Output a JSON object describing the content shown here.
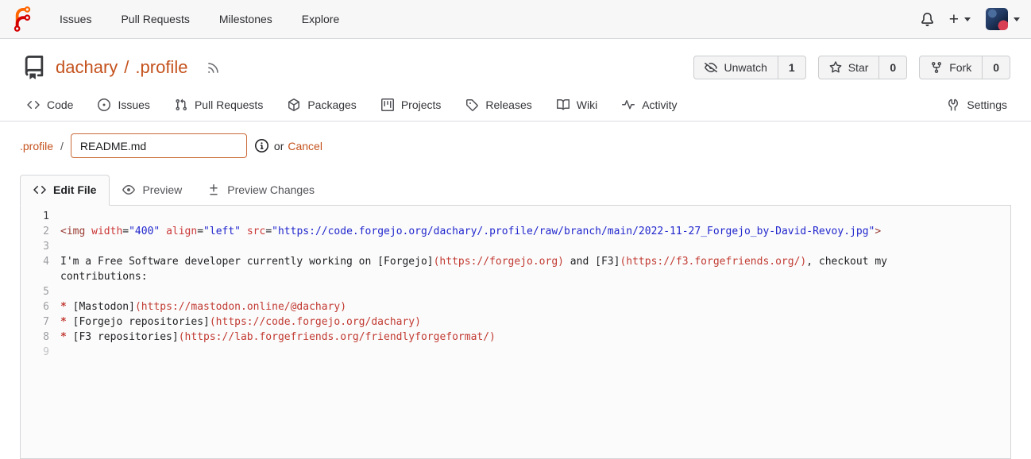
{
  "navbar": {
    "logo_icon": "forgejo-logo",
    "links": [
      "Issues",
      "Pull Requests",
      "Milestones",
      "Explore"
    ],
    "bell_icon": "bell",
    "new_label": "+"
  },
  "repo_header": {
    "repo_icon": "repo",
    "owner": "dachary",
    "separator": "/",
    "name": ".profile",
    "rss_icon": "rss",
    "actions": [
      {
        "icon": "eye-closed",
        "label": "Unwatch",
        "count": "1"
      },
      {
        "icon": "star",
        "label": "Star",
        "count": "0"
      },
      {
        "icon": "fork",
        "label": "Fork",
        "count": "0"
      }
    ]
  },
  "repo_tabs": [
    {
      "icon": "code",
      "label": "Code"
    },
    {
      "icon": "issue",
      "label": "Issues"
    },
    {
      "icon": "pull",
      "label": "Pull Requests"
    },
    {
      "icon": "package",
      "label": "Packages"
    },
    {
      "icon": "project",
      "label": "Projects"
    },
    {
      "icon": "tag",
      "label": "Releases"
    },
    {
      "icon": "book",
      "label": "Wiki"
    },
    {
      "icon": "pulse",
      "label": "Activity"
    }
  ],
  "settings_tab": {
    "icon": "tools",
    "label": "Settings"
  },
  "file_editor": {
    "breadcrumb_dir": ".profile",
    "breadcrumb_sep": "/",
    "filename_value": "README.md",
    "info_icon": "info",
    "or_text": "or",
    "cancel_label": "Cancel",
    "tabs": [
      {
        "icon": "code",
        "label": "Edit File",
        "active": true
      },
      {
        "icon": "eye",
        "label": "Preview",
        "active": false
      },
      {
        "icon": "diff",
        "label": "Preview Changes",
        "active": false
      }
    ],
    "lines": [
      {
        "n": "1",
        "active": true,
        "tokens": []
      },
      {
        "n": "2",
        "tokens": [
          {
            "c": "tag",
            "t": "<img"
          },
          {
            "c": "plain",
            "t": " "
          },
          {
            "c": "attr",
            "t": "width"
          },
          {
            "c": "plain",
            "t": "="
          },
          {
            "c": "str",
            "t": "\"400\""
          },
          {
            "c": "plain",
            "t": " "
          },
          {
            "c": "attr",
            "t": "align"
          },
          {
            "c": "plain",
            "t": "="
          },
          {
            "c": "str",
            "t": "\"left\""
          },
          {
            "c": "plain",
            "t": " "
          },
          {
            "c": "attr",
            "t": "src"
          },
          {
            "c": "plain",
            "t": "="
          },
          {
            "c": "str",
            "t": "\"https://code.forgejo.org/dachary/.profile/raw/branch/main/2022-11-27_Forgejo_by-David-Revoy.jpg\""
          },
          {
            "c": "tag",
            "t": ">"
          }
        ]
      },
      {
        "n": "3",
        "tokens": []
      },
      {
        "n": "4",
        "tokens": [
          {
            "c": "plain",
            "t": "I'm a Free Software developer currently working on [Forgejo]"
          },
          {
            "c": "url",
            "t": "(https://forgejo.org)"
          },
          {
            "c": "plain",
            "t": " and [F3]"
          },
          {
            "c": "url",
            "t": "(https://f3.forgefriends.org/)"
          },
          {
            "c": "plain",
            "t": ", checkout my contributions:"
          }
        ]
      },
      {
        "n": "5",
        "tokens": []
      },
      {
        "n": "6",
        "tokens": [
          {
            "c": "bullet",
            "t": "* "
          },
          {
            "c": "plain",
            "t": "[Mastodon]"
          },
          {
            "c": "url",
            "t": "(https://mastodon.online/@dachary)"
          }
        ]
      },
      {
        "n": "7",
        "tokens": [
          {
            "c": "bullet",
            "t": "* "
          },
          {
            "c": "plain",
            "t": "[Forgejo repositories]"
          },
          {
            "c": "url",
            "t": "(https://code.forgejo.org/dachary)"
          }
        ]
      },
      {
        "n": "8",
        "tokens": [
          {
            "c": "bullet",
            "t": "* "
          },
          {
            "c": "plain",
            "t": "[F3 repositories]"
          },
          {
            "c": "url",
            "t": "(https://lab.forgefriends.org/friendlyforgeformat/)"
          }
        ]
      },
      {
        "n": "9",
        "dim": true,
        "tokens": []
      }
    ]
  },
  "colors": {
    "accent": "#c4521d",
    "logo_orange": "#ff6600",
    "logo_red": "#d40000",
    "navbar_bg": "#f7f7f8",
    "border": "#d8d9db",
    "button_bg": "#f4f4f5",
    "text": "#2c2d30",
    "editor_bg": "#fbfbfb",
    "line_number": "#9d9ea2",
    "input_border": "#cb6a38",
    "syntax_tag": "#9a3c34",
    "syntax_attr": "#cc3838",
    "syntax_string": "#2127cd",
    "syntax_url": "#c23b33"
  }
}
